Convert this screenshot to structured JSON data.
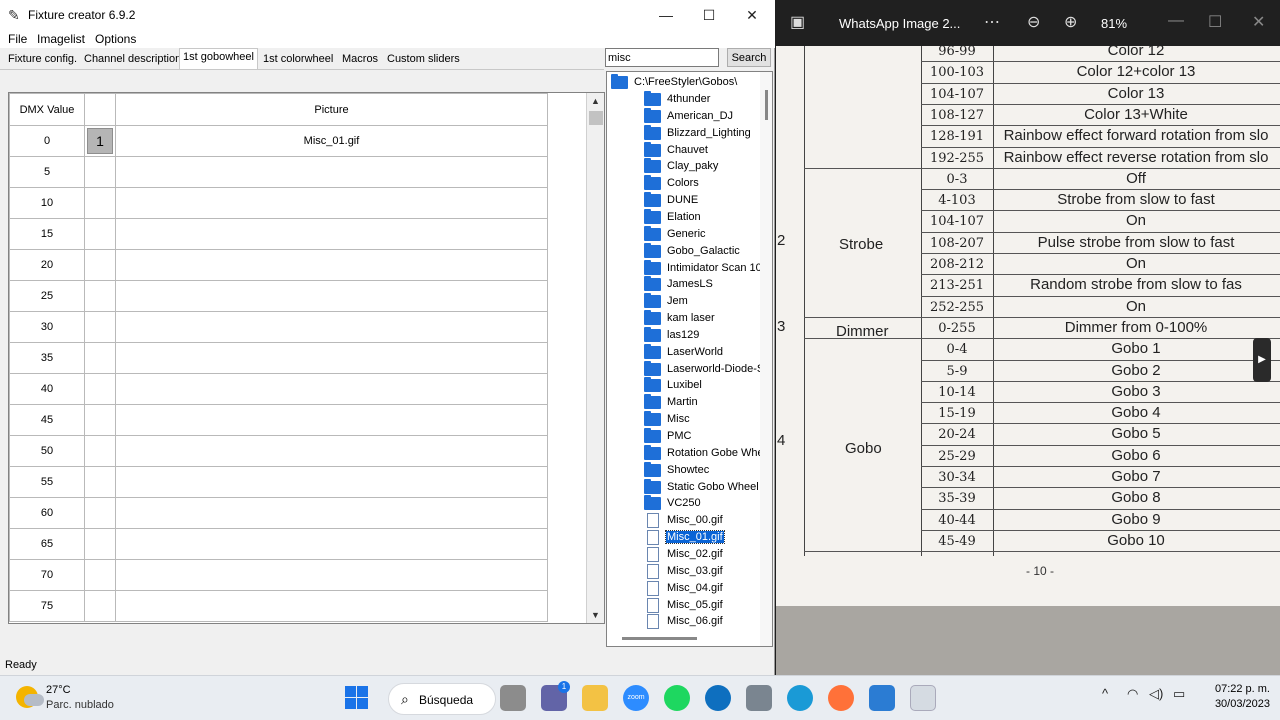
{
  "app": {
    "title": "Fixture creator 6.9.2",
    "menu": [
      "File",
      "Imagelist",
      "Options"
    ],
    "tabs": [
      "Fixture config.",
      "Channel description",
      "1st gobowheel",
      "1st colorwheel",
      "Macros",
      "Custom sliders"
    ],
    "active_tab": "1st gobowheel",
    "search_value": "misc",
    "search_button": "Search",
    "grid_headers": [
      "DMX Value",
      "",
      "Picture"
    ],
    "grid_rows": [
      {
        "dmx": "0",
        "slot": "1",
        "picture": "Misc_01.gif"
      },
      {
        "dmx": "5",
        "slot": "",
        "picture": ""
      },
      {
        "dmx": "10",
        "slot": "",
        "picture": ""
      },
      {
        "dmx": "15",
        "slot": "",
        "picture": ""
      },
      {
        "dmx": "20",
        "slot": "",
        "picture": ""
      },
      {
        "dmx": "25",
        "slot": "",
        "picture": ""
      },
      {
        "dmx": "30",
        "slot": "",
        "picture": ""
      },
      {
        "dmx": "35",
        "slot": "",
        "picture": ""
      },
      {
        "dmx": "40",
        "slot": "",
        "picture": ""
      },
      {
        "dmx": "45",
        "slot": "",
        "picture": ""
      },
      {
        "dmx": "50",
        "slot": "",
        "picture": ""
      },
      {
        "dmx": "55",
        "slot": "",
        "picture": ""
      },
      {
        "dmx": "60",
        "slot": "",
        "picture": ""
      },
      {
        "dmx": "65",
        "slot": "",
        "picture": ""
      },
      {
        "dmx": "70",
        "slot": "",
        "picture": ""
      },
      {
        "dmx": "75",
        "slot": "",
        "picture": ""
      }
    ],
    "tree_root": "C:\\FreeStyler\\Gobos\\",
    "tree_folders": [
      "4thunder",
      "American_DJ",
      "Blizzard_Lighting",
      "Chauvet",
      "Clay_paky",
      "Colors",
      "DUNE",
      "Elation",
      "Generic",
      "Gobo_Galactic",
      "Intimidator Scan 100",
      "JamesLS",
      "Jem",
      "kam laser",
      "las129",
      "LaserWorld",
      "Laserworld-Diode-S",
      "Luxibel",
      "Martin",
      "Misc",
      "PMC",
      "Rotation Gobe Whee",
      "Showtec",
      "Static Gobo Wheel",
      "VC250"
    ],
    "tree_files": [
      "Misc_00.gif",
      "Misc_01.gif",
      "Misc_02.gif",
      "Misc_03.gif",
      "Misc_04.gif",
      "Misc_05.gif",
      "Misc_06.gif"
    ],
    "selected_file": "Misc_01.gif",
    "status": "Ready"
  },
  "viewer": {
    "title": "WhatsApp Image 2...",
    "zoom": "81%",
    "photo": {
      "rows_top": [
        {
          "range": "96-99",
          "desc": "Color 12"
        },
        {
          "range": "100-103",
          "desc": "Color 12+color 13"
        },
        {
          "range": "104-107",
          "desc": "Color 13"
        },
        {
          "range": "108-127",
          "desc": "Color 13+White"
        },
        {
          "range": "128-191",
          "desc": "Rainbow effect forward rotation from slo"
        },
        {
          "range": "192-255",
          "desc": "Rainbow effect reverse rotation from slo"
        }
      ],
      "strobe_label": "Strobe",
      "strobe_channel": "2",
      "strobe_rows": [
        {
          "range": "0-3",
          "desc": "Off"
        },
        {
          "range": "4-103",
          "desc": "Strobe from slow to fast"
        },
        {
          "range": "104-107",
          "desc": "On"
        },
        {
          "range": "108-207",
          "desc": "Pulse strobe from slow to fast"
        },
        {
          "range": "208-212",
          "desc": "On"
        },
        {
          "range": "213-251",
          "desc": "Random strobe from slow to fas"
        },
        {
          "range": "252-255",
          "desc": "On"
        }
      ],
      "dimmer_channel": "3",
      "dimmer_label": "Dimmer",
      "dimmer_row": {
        "range": "0-255",
        "desc": "Dimmer from 0-100%"
      },
      "gobo_channel": "4",
      "gobo_label": "Gobo",
      "gobo_rows": [
        {
          "range": "0-4",
          "desc": "Gobo 1"
        },
        {
          "range": "5-9",
          "desc": "Gobo 2"
        },
        {
          "range": "10-14",
          "desc": "Gobo 3"
        },
        {
          "range": "15-19",
          "desc": "Gobo 4"
        },
        {
          "range": "20-24",
          "desc": "Gobo 5"
        },
        {
          "range": "25-29",
          "desc": "Gobo 6"
        },
        {
          "range": "30-34",
          "desc": "Gobo 7"
        },
        {
          "range": "35-39",
          "desc": "Gobo 8"
        },
        {
          "range": "40-44",
          "desc": "Gobo 9"
        },
        {
          "range": "45-49",
          "desc": "Gobo 10"
        }
      ],
      "page_number": "- 10 -"
    }
  },
  "taskbar": {
    "temperature": "27°C",
    "weather": "Parc. nublado",
    "search_label": "Búsqueda",
    "chat_badge": "1",
    "zoom_label": "zoom",
    "time": "07:22 p. m.",
    "date": "30/03/2023"
  },
  "colors": {
    "selection": "#0a64d6",
    "folder": "#1e6fd8",
    "accent": "#1a73e8"
  }
}
